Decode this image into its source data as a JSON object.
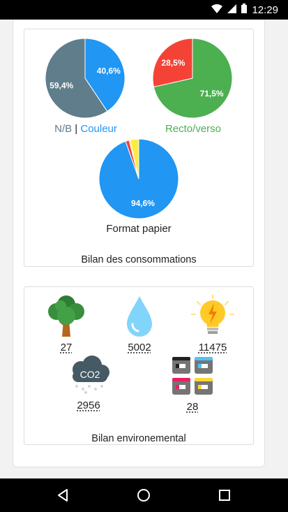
{
  "status_bar": {
    "time": "12:29",
    "icons": [
      "wifi-icon",
      "signal-icon",
      "battery-icon"
    ]
  },
  "consumption": {
    "caption": "Bilan des consommations",
    "color_pie": {
      "slices": [
        {
          "label": "40,6%",
          "value": 40.6,
          "color": "#2196f3"
        },
        {
          "label": "59,4%",
          "value": 59.4,
          "color": "#607d8b"
        }
      ],
      "legend_bw": "N/B",
      "legend_sep": " | ",
      "legend_color": "Couleur",
      "legend_bw_color": "#607d8b",
      "legend_color_color": "#2196f3"
    },
    "duplex_pie": {
      "slices": [
        {
          "label": "71,5%",
          "value": 71.5,
          "color": "#4caf50"
        },
        {
          "label": "28,5%",
          "value": 28.5,
          "color": "#f44336"
        }
      ],
      "legend": "Recto/verso",
      "legend_color": "#4caf50"
    },
    "format_pie": {
      "slices": [
        {
          "label": "94,6%",
          "value": 94.6,
          "color": "#2196f3"
        },
        {
          "label": "",
          "value": 1.5,
          "color": "#f44336"
        },
        {
          "label": "",
          "value": 0.4,
          "color": "#ff9800"
        },
        {
          "label": "",
          "value": 3.5,
          "color": "#ffeb3b"
        }
      ],
      "legend": "Format papier"
    }
  },
  "environment": {
    "caption": "Bilan environemental",
    "items": [
      {
        "icon": "tree-icon",
        "value": "27"
      },
      {
        "icon": "water-drop-icon",
        "value": "5002"
      },
      {
        "icon": "lightbulb-icon",
        "value": "11475"
      },
      {
        "icon": "co2-cloud-icon",
        "value": "2956",
        "icon_text": "CO2"
      },
      {
        "icon": "ink-cartridges-icon",
        "value": "28"
      }
    ]
  },
  "nav_bar": {
    "buttons": [
      "back-icon",
      "home-icon",
      "recents-icon"
    ]
  }
}
